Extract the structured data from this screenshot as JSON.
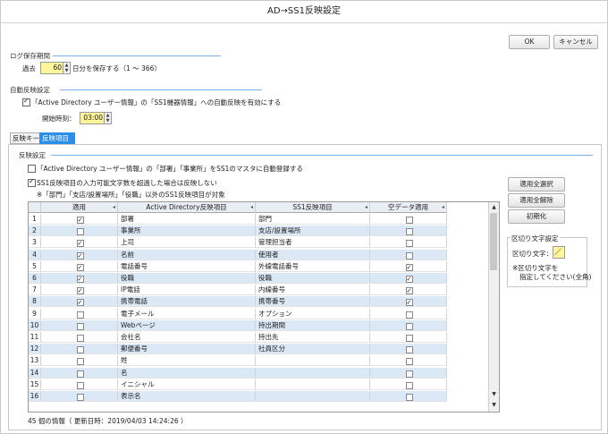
{
  "window": {
    "title": "AD→SS1反映設定"
  },
  "buttons": {
    "ok": "OK",
    "cancel": "キャンセル",
    "select_all": "適用全選択",
    "clear_all": "適用全解除",
    "reset": "初期化"
  },
  "log": {
    "section": "ログ保存期間",
    "prefix": "過去",
    "days": "60",
    "suffix": "日分を保存する（1 ～ 366）"
  },
  "auto": {
    "section": "自動反映設定",
    "enable_label": "「Active Directory ユーザー情報」の「SS1機器情報」への自動反映を有効にする",
    "enable_checked": true,
    "start_label": "開始時刻：",
    "start_time": "03:00"
  },
  "tabs": [
    {
      "label": "反映キー",
      "active": false
    },
    {
      "label": "反映項目",
      "active": true
    }
  ],
  "reflect": {
    "section": "反映設定",
    "opt1": "「Active Directory ユーザー情報」の「部署」「事業所」をSS1のマスタに自動登録する",
    "opt1_checked": false,
    "opt2": "SS1反映項目の入力可能文字数を超過した場合は反映しない",
    "opt2_checked": true,
    "note": "※「部門」「支店/設置場所」「役職」以外のSS1反映項目が対象"
  },
  "grid": {
    "headers": {
      "apply": "適用",
      "ad_item": "Active Directory反映項目",
      "ss1_item": "SS1反映項目",
      "empty": "空データ適用"
    },
    "rows": [
      {
        "no": "1",
        "apply": true,
        "ad": "部署",
        "ss1": "部門",
        "empty": false
      },
      {
        "no": "2",
        "apply": false,
        "ad": "事業所",
        "ss1": "支店/設置場所",
        "empty": false
      },
      {
        "no": "3",
        "apply": true,
        "ad": "上司",
        "ss1": "管理担当者",
        "empty": false
      },
      {
        "no": "4",
        "apply": true,
        "ad": "名前",
        "ss1": "使用者",
        "empty": false
      },
      {
        "no": "5",
        "apply": true,
        "ad": "電話番号",
        "ss1": "外線電話番号",
        "empty": true
      },
      {
        "no": "6",
        "apply": true,
        "ad": "役職",
        "ss1": "役職",
        "empty": true
      },
      {
        "no": "7",
        "apply": true,
        "ad": "IP電話",
        "ss1": "内線番号",
        "empty": true
      },
      {
        "no": "8",
        "apply": true,
        "ad": "携帯電話",
        "ss1": "携帯番号",
        "empty": true
      },
      {
        "no": "9",
        "apply": false,
        "ad": "電子メール",
        "ss1": "オプション",
        "empty": false
      },
      {
        "no": "10",
        "apply": false,
        "ad": "Webページ",
        "ss1": "持出期間",
        "empty": false
      },
      {
        "no": "11",
        "apply": false,
        "ad": "会社名",
        "ss1": "持出先",
        "empty": false
      },
      {
        "no": "12",
        "apply": false,
        "ad": "郵便番号",
        "ss1": "社員区分",
        "empty": false
      },
      {
        "no": "13",
        "apply": false,
        "ad": "姓",
        "ss1": "",
        "empty": false
      },
      {
        "no": "14",
        "apply": false,
        "ad": "名",
        "ss1": "",
        "empty": false
      },
      {
        "no": "15",
        "apply": false,
        "ad": "イニシャル",
        "ss1": "",
        "empty": false
      },
      {
        "no": "16",
        "apply": false,
        "ad": "表示名",
        "ss1": "",
        "empty": false
      }
    ]
  },
  "delimiter": {
    "section": "区切り文字設定",
    "label": "区切り文字：",
    "value": "／",
    "note1": "※区切り文字を",
    "note2": "指定してください(全角)"
  },
  "status": "45 個の情報（ 更新日時：2019/04/03 14:24:26 ）",
  "icons": {
    "sort": "◂",
    "up": "▲",
    "down": "▼"
  }
}
